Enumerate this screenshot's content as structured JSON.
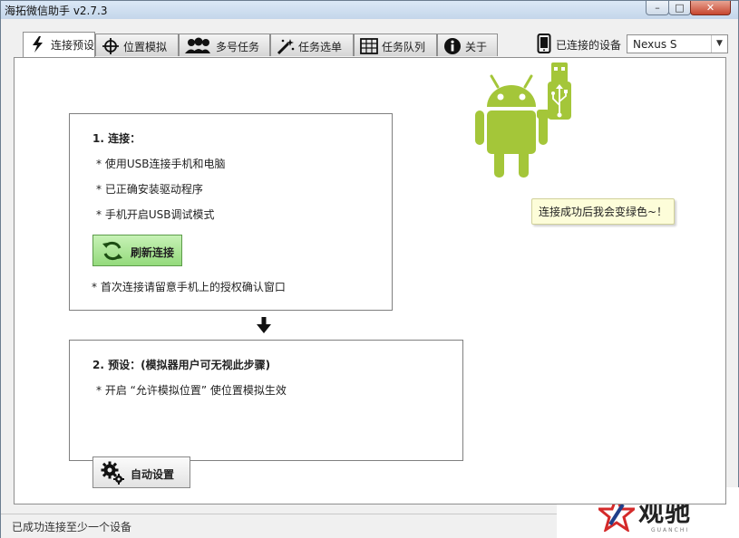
{
  "window": {
    "title": "海拓微信助手 v2.7.3",
    "minimize_glyph": "–",
    "maximize_glyph": "□",
    "close_glyph": "✕"
  },
  "tabs": [
    {
      "label": "连接预设",
      "icon": "lightning-icon",
      "active": true
    },
    {
      "label": "位置模拟",
      "icon": "crosshair-icon",
      "active": false
    },
    {
      "label": "多号任务",
      "icon": "users-icon",
      "active": false
    },
    {
      "label": "任务选单",
      "icon": "magic-wand-icon",
      "active": false
    },
    {
      "label": "任务队列",
      "icon": "table-icon",
      "active": false
    },
    {
      "label": "关于",
      "icon": "info-icon",
      "active": false
    }
  ],
  "device": {
    "label": "已连接的设备",
    "selected": "Nexus S"
  },
  "step1": {
    "title": "1. 连接：",
    "lines": [
      "* 使用USB连接手机和电脑",
      "* 已正确安装驱动程序",
      "* 手机开启USB调试模式"
    ],
    "button_label": "刷新连接",
    "note": "* 首次连接请留意手机上的授权确认窗口"
  },
  "step2": {
    "title": "2. 预设：(模拟器用户可无视此步骤)",
    "line": "* 开启 “允许模拟位置” 使位置模拟生效",
    "button_label": "自动设置"
  },
  "tooltip": "连接成功后我会变绿色~！",
  "status": "已成功连接至少一个设备",
  "watermark": {
    "text": "观驰",
    "sub": "GUANCHI"
  },
  "colors": {
    "android_green": "#a4c639",
    "refresh_button": "#a6e28e",
    "tooltip_bg": "#fdfdd9"
  }
}
